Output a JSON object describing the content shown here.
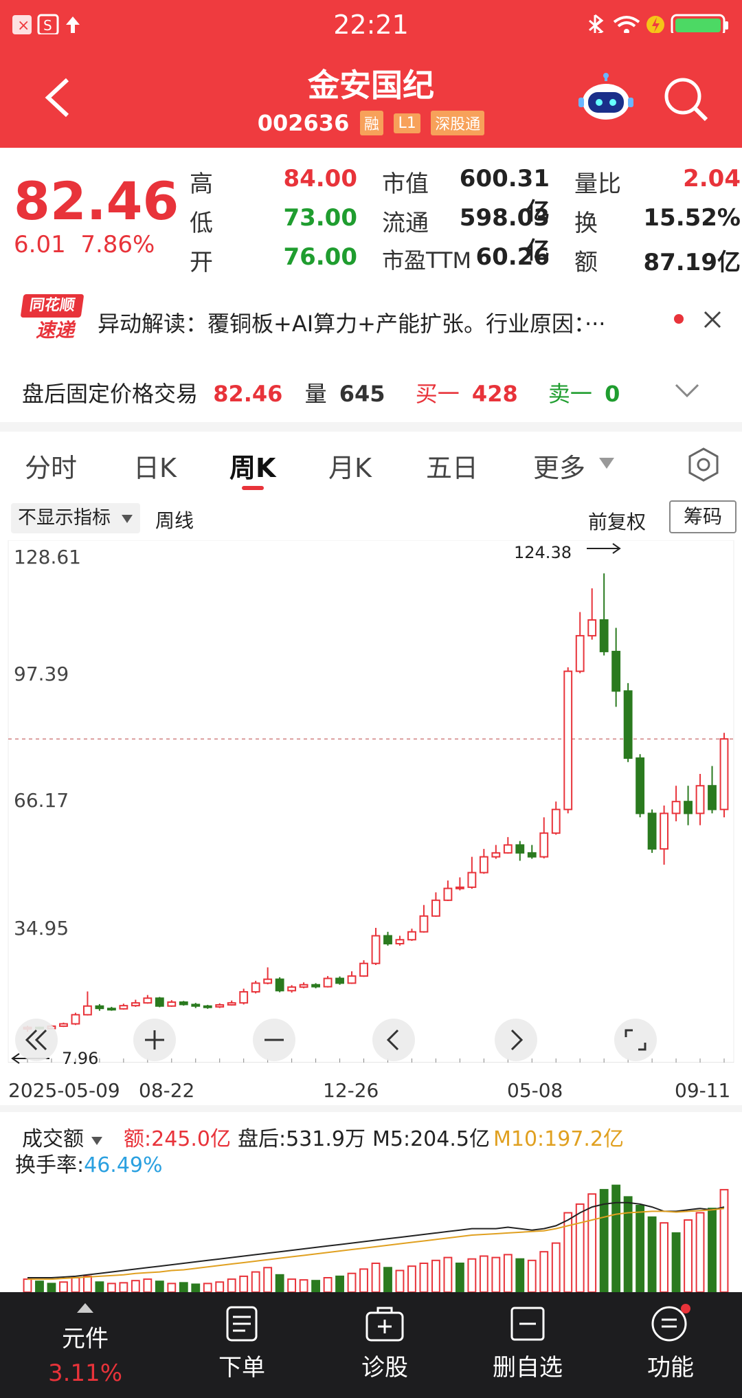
{
  "status_bar": {
    "time": "22:21"
  },
  "header": {
    "title": "金安国纪",
    "code": "002636",
    "tags": [
      "融",
      "L1",
      "深股通"
    ]
  },
  "quote": {
    "price": "82.46",
    "change": "6.01",
    "change_pct": "7.86%",
    "fields": [
      {
        "label": "高",
        "value": "84.00"
      },
      {
        "label": "低",
        "value": "73.00"
      },
      {
        "label": "开",
        "value": "76.00"
      },
      {
        "label": "市值",
        "value": "600.31亿"
      },
      {
        "label": "流通",
        "value": "598.03亿"
      },
      {
        "label": "市盈TTM",
        "value": "60.26"
      },
      {
        "label": "量比",
        "value": "2.04"
      },
      {
        "label": "换",
        "value": "15.52%"
      },
      {
        "label": "额",
        "value": "87.19亿"
      }
    ]
  },
  "news": {
    "badge_top": "同花顺",
    "badge_bottom": "速递",
    "text": "异动解读：覆铜板+AI算力+产能扩张。行业原因：···"
  },
  "after_hours": {
    "label": "盘后固定价格交易",
    "price": "82.46",
    "vol_label": "量",
    "vol": "645",
    "buy1_label": "买一",
    "buy1": "428",
    "sell1_label": "卖一",
    "sell1": "0"
  },
  "tabs": [
    "分时",
    "日K",
    "周K",
    "月K",
    "五日",
    "更多"
  ],
  "chart_controls": {
    "indicator": "不显示指标",
    "period": "周线",
    "adjust": "前复权",
    "chips": "筹码"
  },
  "chart_data": {
    "type": "candlestick",
    "yticks": [
      "128.61",
      "97.39",
      "66.17",
      "34.95"
    ],
    "ytick_values": [
      128.61,
      97.39,
      66.17,
      34.95
    ],
    "high_annotation": "124.38",
    "low_annotation": "7.96",
    "x_labels": [
      "2025-05-09",
      "08-22",
      "12-26",
      "05-08",
      "09-11"
    ],
    "current_price": 82.46,
    "candles": [
      [
        9,
        9.4,
        8.3,
        9.8
      ],
      [
        9.4,
        9.1,
        8.8,
        9.6
      ],
      [
        9.1,
        9.7,
        8.9,
        10
      ],
      [
        9.7,
        10.3,
        9.5,
        10.6
      ],
      [
        10.3,
        12.6,
        10,
        13.1
      ],
      [
        12.6,
        14.8,
        12.4,
        18.5
      ],
      [
        14.8,
        14.2,
        13.6,
        15.3
      ],
      [
        14.2,
        14.1,
        13.6,
        14.6
      ],
      [
        14.1,
        14.9,
        13.9,
        15.4
      ],
      [
        14.9,
        15.6,
        14.6,
        16.4
      ],
      [
        15.6,
        16.8,
        15.4,
        17.6
      ],
      [
        16.8,
        14.8,
        14.5,
        17.1
      ],
      [
        14.8,
        15.8,
        14.6,
        16.3
      ],
      [
        15.8,
        15.2,
        14.9,
        16.1
      ],
      [
        15.2,
        14.8,
        14.3,
        15.6
      ],
      [
        14.8,
        14.6,
        14.1,
        15.1
      ],
      [
        14.6,
        15.1,
        14.3,
        15.5
      ],
      [
        15.1,
        15.6,
        14.9,
        16.2
      ],
      [
        15.6,
        18.4,
        15.2,
        19.2
      ],
      [
        18.4,
        20.6,
        18,
        21.2
      ],
      [
        20.6,
        21.6,
        20.3,
        24.6
      ],
      [
        21.6,
        18.7,
        18.3,
        22.1
      ],
      [
        18.7,
        19.6,
        18.2,
        20.1
      ],
      [
        19.6,
        20.2,
        19.3,
        20.8
      ],
      [
        20.2,
        19.7,
        19.3,
        20.6
      ],
      [
        19.7,
        21.8,
        19.5,
        22.4
      ],
      [
        21.8,
        20.6,
        20.2,
        22.3
      ],
      [
        20.6,
        22.4,
        20.4,
        23.6
      ],
      [
        22.4,
        25.6,
        22.2,
        26.4
      ],
      [
        25.6,
        32.6,
        25.2,
        34.6
      ],
      [
        32.6,
        30.6,
        30.1,
        33.6
      ],
      [
        30.6,
        31.6,
        30.1,
        32.6
      ],
      [
        31.6,
        33.6,
        31.3,
        34.4
      ],
      [
        33.6,
        37.6,
        33.4,
        40.4
      ],
      [
        37.6,
        41.6,
        37.4,
        43.6
      ],
      [
        41.6,
        44.6,
        41.4,
        46.6
      ],
      [
        44.6,
        44.9,
        44.1,
        47.4
      ],
      [
        44.9,
        48.6,
        44.5,
        52.6
      ],
      [
        48.6,
        52.6,
        48.3,
        54.6
      ],
      [
        52.6,
        53.6,
        52.1,
        55.6
      ],
      [
        53.6,
        55.6,
        53.4,
        57.6
      ],
      [
        55.6,
        53.6,
        51.6,
        56.6
      ],
      [
        53.6,
        52.6,
        52.1,
        55.6
      ],
      [
        52.6,
        58.6,
        52.2,
        62.6
      ],
      [
        58.6,
        64.6,
        58.2,
        66.6
      ],
      [
        64.6,
        99.6,
        63.6,
        100.6
      ],
      [
        99.6,
        108.6,
        99.1,
        114.6
      ],
      [
        108.6,
        112.6,
        107.6,
        120.6
      ],
      [
        112.6,
        104.6,
        103.6,
        124.38
      ],
      [
        104.6,
        94.6,
        90.6,
        110.6
      ],
      [
        94.6,
        77.6,
        76.6,
        96.6
      ],
      [
        77.6,
        63.6,
        62.6,
        78.6
      ],
      [
        63.6,
        54.6,
        53.6,
        64.6
      ],
      [
        54.6,
        63.6,
        50.6,
        65.6
      ],
      [
        63.6,
        66.6,
        61.6,
        70.6
      ],
      [
        66.6,
        63.6,
        60.6,
        70.6
      ],
      [
        63.6,
        70.6,
        60.6,
        73.6
      ],
      [
        70.6,
        64.6,
        63.6,
        75.6
      ],
      [
        64.6,
        82.46,
        62.6,
        84
      ]
    ]
  },
  "volume": {
    "label": "成交额",
    "amount_label": "额:",
    "amount": "245.0亿",
    "after_label": "盘后:",
    "after": "531.9万",
    "m5_label": "M5:",
    "m5": "204.5亿",
    "m10_label": "M10:",
    "m10": "197.2亿",
    "turnover_label": "换手率:",
    "turnover": "46.49%",
    "bars": [
      [
        18,
        1
      ],
      [
        15,
        0
      ],
      [
        12,
        0
      ],
      [
        14,
        1
      ],
      [
        20,
        1
      ],
      [
        22,
        1
      ],
      [
        14,
        0
      ],
      [
        12,
        1
      ],
      [
        13,
        1
      ],
      [
        16,
        1
      ],
      [
        18,
        1
      ],
      [
        15,
        0
      ],
      [
        12,
        1
      ],
      [
        13,
        0
      ],
      [
        11,
        0
      ],
      [
        12,
        1
      ],
      [
        14,
        1
      ],
      [
        18,
        1
      ],
      [
        22,
        1
      ],
      [
        28,
        1
      ],
      [
        34,
        1
      ],
      [
        24,
        0
      ],
      [
        18,
        1
      ],
      [
        17,
        1
      ],
      [
        16,
        0
      ],
      [
        20,
        1
      ],
      [
        22,
        0
      ],
      [
        26,
        1
      ],
      [
        32,
        1
      ],
      [
        40,
        1
      ],
      [
        34,
        0
      ],
      [
        30,
        1
      ],
      [
        36,
        1
      ],
      [
        40,
        1
      ],
      [
        44,
        1
      ],
      [
        48,
        1
      ],
      [
        40,
        0
      ],
      [
        46,
        1
      ],
      [
        50,
        1
      ],
      [
        48,
        1
      ],
      [
        52,
        1
      ],
      [
        46,
        0
      ],
      [
        44,
        1
      ],
      [
        56,
        1
      ],
      [
        68,
        1
      ],
      [
        110,
        1
      ],
      [
        122,
        1
      ],
      [
        136,
        1
      ],
      [
        142,
        0
      ],
      [
        148,
        0
      ],
      [
        132,
        0
      ],
      [
        120,
        0
      ],
      [
        104,
        0
      ],
      [
        96,
        1
      ],
      [
        82,
        0
      ],
      [
        100,
        1
      ],
      [
        110,
        1
      ],
      [
        116,
        0
      ],
      [
        142,
        1
      ]
    ],
    "m5_line": [
      20,
      20,
      20,
      21,
      22,
      24,
      26,
      28,
      30,
      32,
      34,
      36,
      38,
      40,
      42,
      44,
      46,
      48,
      50,
      52,
      54,
      56,
      58,
      60,
      62,
      64,
      66,
      68,
      70,
      72,
      74,
      76,
      78,
      80,
      82,
      84,
      86,
      88,
      88,
      88,
      90,
      88,
      86,
      88,
      92,
      100,
      110,
      118,
      122,
      124,
      124,
      122,
      118,
      112,
      112,
      114,
      116,
      114,
      118
    ],
    "m10_line": [
      18,
      18,
      18,
      19,
      20,
      21,
      22,
      23,
      24,
      26,
      27,
      28,
      30,
      31,
      33,
      35,
      37,
      39,
      41,
      43,
      45,
      47,
      49,
      51,
      53,
      55,
      57,
      59,
      61,
      63,
      65,
      67,
      69,
      71,
      73,
      75,
      77,
      79,
      80,
      81,
      82,
      83,
      84,
      85,
      88,
      92,
      96,
      100,
      104,
      108,
      110,
      111,
      112,
      112,
      111,
      112,
      113,
      114,
      116
    ]
  },
  "bottom_nav": [
    {
      "label": "元件",
      "sub": "3.11%"
    },
    {
      "label": "下单"
    },
    {
      "label": "诊股"
    },
    {
      "label": "删自选"
    },
    {
      "label": "功能"
    }
  ],
  "colors": {
    "header_red": "#ef3b3f",
    "up_red": "#e8333a",
    "down_green": "#2a7a1f",
    "m10_orange": "#e0a020",
    "turnover_blue": "#2aa0e0"
  }
}
